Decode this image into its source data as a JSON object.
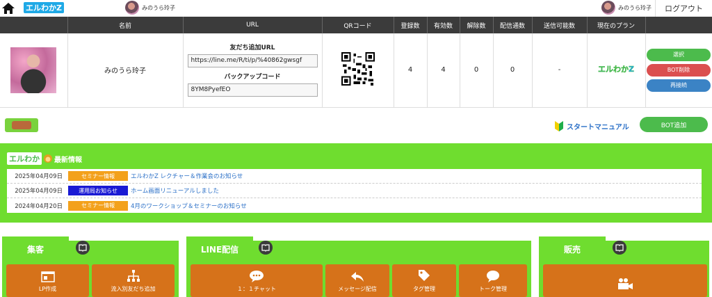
{
  "header": {
    "logo_text": "エルわかZ",
    "user_left": "みのうら玲子",
    "user_right": "みのうら玲子",
    "logout": "ログアウト"
  },
  "table": {
    "headers": [
      "",
      "名前",
      "URL",
      "QRコード",
      "登録数",
      "有効数",
      "解除数",
      "配信通数",
      "送信可能数",
      "現在のプラン",
      ""
    ],
    "row": {
      "name": "みのうら玲子",
      "friend_url_label": "友だち追加URL",
      "friend_url": "https://line.me/R/ti/p/%40862gwsgf",
      "backup_label": "バックアップコード",
      "backup_code": "8YM8PyefEO",
      "registered": "4",
      "valid": "4",
      "unsubscribed": "0",
      "delivered": "0",
      "sendable": "-",
      "plan": "エルわかZ",
      "btn_select": "選択",
      "btn_delete": "BOT削除",
      "btn_reconnect": "再接続"
    }
  },
  "toolbar": {
    "manual": "スタートマニュアル",
    "bot_add": "BOT追加"
  },
  "news": {
    "logo": "エルわか",
    "title": "最新情報",
    "items": [
      {
        "date": "2025年04月09日",
        "category": "セミナー情報",
        "color": "#f3a11c",
        "text": "エルわかZ レクチャー＆作業会のお知らせ"
      },
      {
        "date": "2025年04月09日",
        "category": "運用局お知らせ",
        "color": "#1a1ad4",
        "text": "ホーム画面リニューアルしました"
      },
      {
        "date": "2024年04月20日",
        "category": "セミナー情報",
        "color": "#f3a11c",
        "text": "4月のワークショップ＆セミナーのお知らせ"
      }
    ]
  },
  "panels": {
    "shukyaku": {
      "title": "集客",
      "tiles": [
        "LP作成",
        "流入別友だち追加"
      ]
    },
    "line": {
      "title": "LINE配信",
      "tiles": [
        "１：１チャット",
        "メッセージ配信",
        "タグ管理",
        "トーク管理"
      ]
    },
    "hanbai": {
      "title": "販売",
      "tiles": [
        ""
      ]
    }
  },
  "colors": {
    "accent_green": "#6fdd2f",
    "tile_orange": "#d6721a",
    "header_dark": "#3b3b3b"
  }
}
